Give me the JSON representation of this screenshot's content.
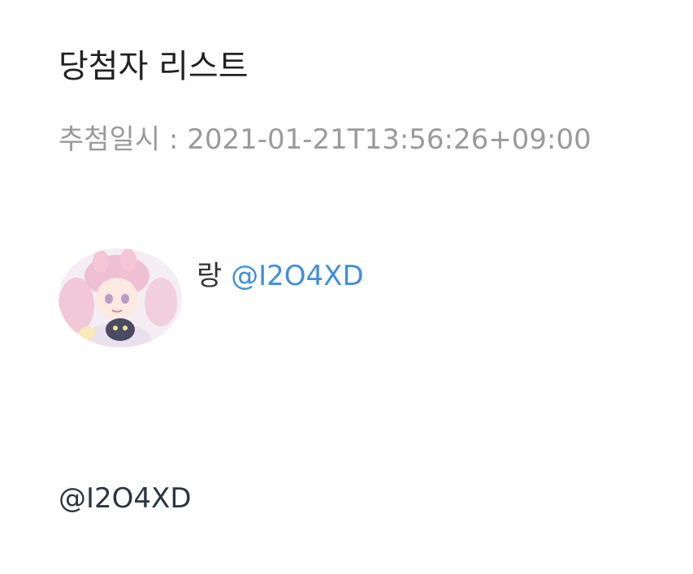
{
  "header": {
    "title": "당첨자 리스트",
    "draw_time_label": "추첨일시",
    "draw_time_separator": " : ",
    "draw_time_value": "2021-01-21T13:56:26+09:00"
  },
  "winners": [
    {
      "avatar_icon": "anime-character-avatar",
      "name": "랑",
      "handle": "@I2O4XD"
    }
  ],
  "footer": {
    "handle": "@I2O4XD"
  },
  "colors": {
    "title": "#222222",
    "meta": "#9a9a9a",
    "link": "#3f8ee0",
    "body_text": "#2e3440"
  }
}
